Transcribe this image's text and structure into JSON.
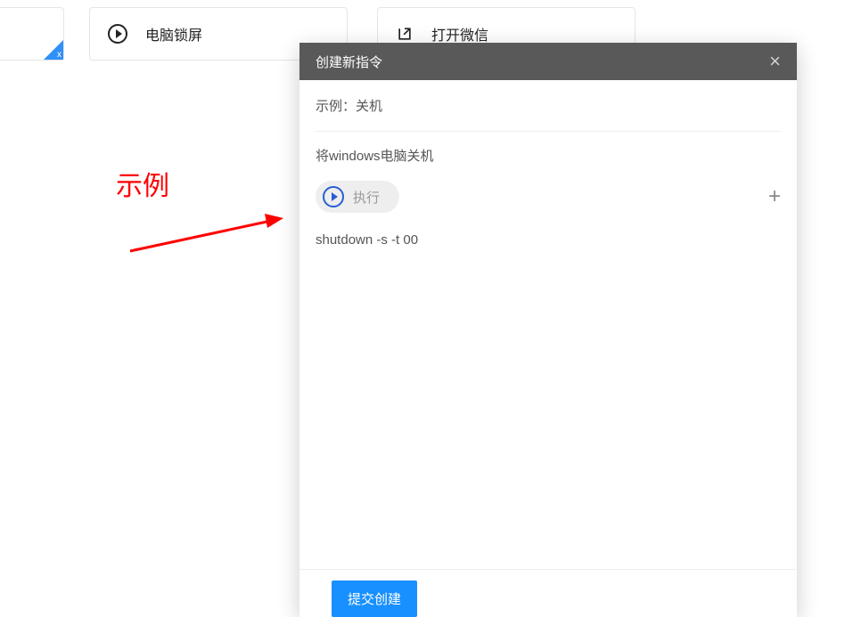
{
  "cards": {
    "lock_screen": {
      "label": "电脑锁屏"
    },
    "open_wechat": {
      "label": "打开微信"
    }
  },
  "annotation": {
    "label": "示例"
  },
  "modal": {
    "title": "创建新指令",
    "example_label": "示例：关机",
    "description": "将windows电脑关机",
    "exec_label": "执行",
    "command": "shutdown -s -t 00",
    "submit_label": "提交创建"
  }
}
